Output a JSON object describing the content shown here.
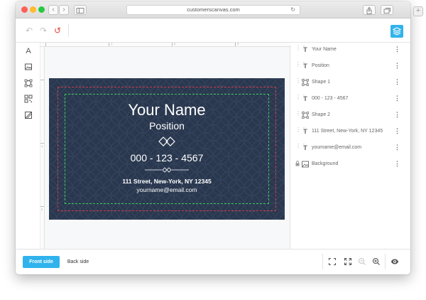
{
  "browser": {
    "url": "customerscanvas.com"
  },
  "card": {
    "name": "Your Name",
    "position": "Position",
    "phone": "000 - 123 - 4567",
    "address": "111 Street, New-York, NY 12345",
    "email": "yourname@email.com"
  },
  "layers": [
    {
      "label": "Your Name",
      "icon": "text-icon"
    },
    {
      "label": "Position",
      "icon": "text-icon"
    },
    {
      "label": "Shape 1",
      "icon": "shape-icon"
    },
    {
      "label": "000 - 123 - 4567",
      "icon": "text-icon"
    },
    {
      "label": "Shape 2",
      "icon": "shape-icon"
    },
    {
      "label": "111 Street, New-York, NY 12345",
      "icon": "text-icon"
    },
    {
      "label": "yourname@email.com",
      "icon": "text-icon"
    },
    {
      "label": "Background",
      "icon": "image-icon"
    }
  ],
  "bottom": {
    "front_label": "Front side",
    "back_label": "Back side"
  },
  "ruler": {
    "top_ticks": [
      "1",
      "2",
      "3"
    ],
    "left_ticks": [
      "1",
      "2"
    ]
  },
  "colors": {
    "accent": "#30b3ec",
    "card_background": "#2a384f",
    "bleed_line": "#d23a4a",
    "safe_line": "#3cc85e"
  }
}
